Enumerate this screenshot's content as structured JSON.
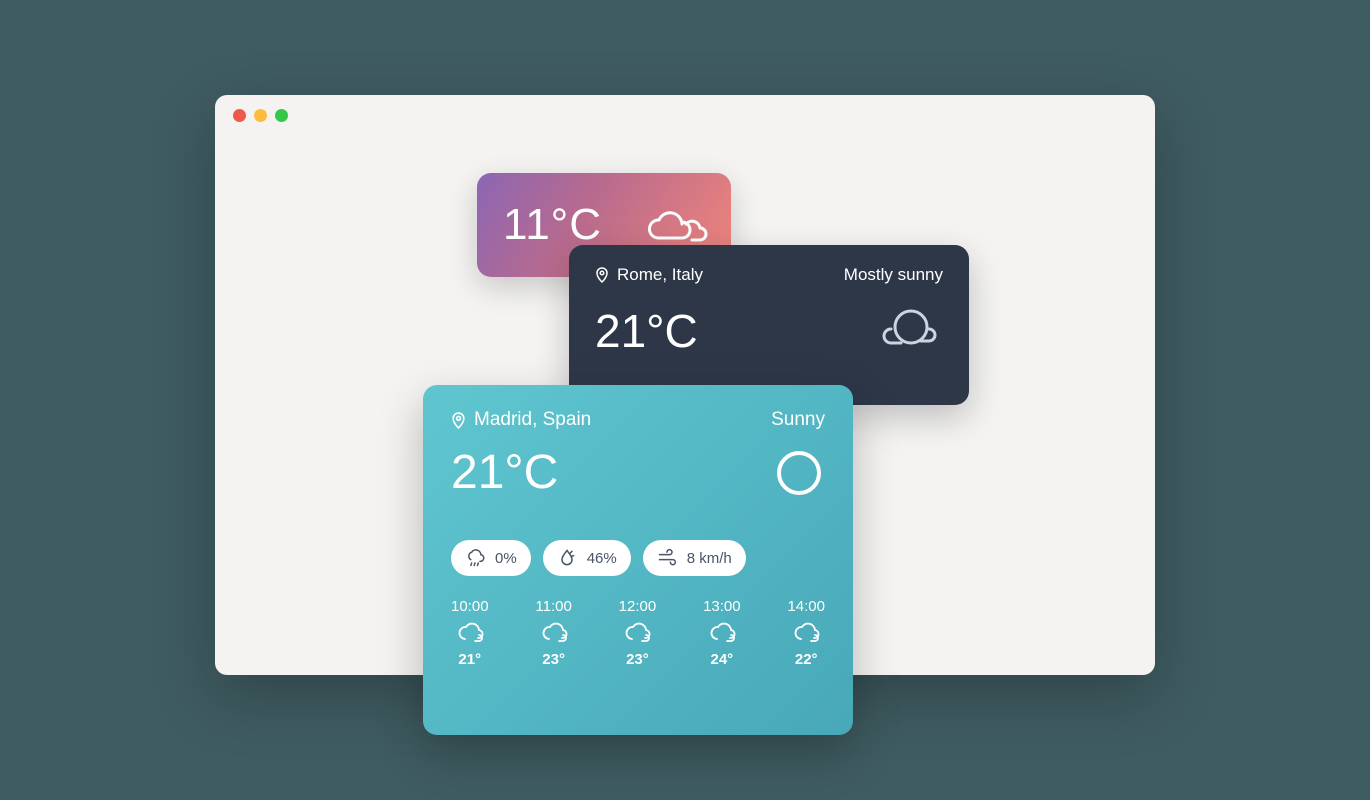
{
  "card_small": {
    "temp": "11°C"
  },
  "card_medium": {
    "location": "Rome, Italy",
    "condition": "Mostly sunny",
    "temp": "21°C"
  },
  "card_large": {
    "location": "Madrid, Spain",
    "condition": "Sunny",
    "temp": "21°C",
    "precip": "0%",
    "humidity": "46%",
    "wind": "8 km/h",
    "hours": [
      {
        "time": "10:00",
        "temp": "21°"
      },
      {
        "time": "11:00",
        "temp": "23°"
      },
      {
        "time": "12:00",
        "temp": "23°"
      },
      {
        "time": "13:00",
        "temp": "24°"
      },
      {
        "time": "14:00",
        "temp": "22°"
      }
    ]
  }
}
